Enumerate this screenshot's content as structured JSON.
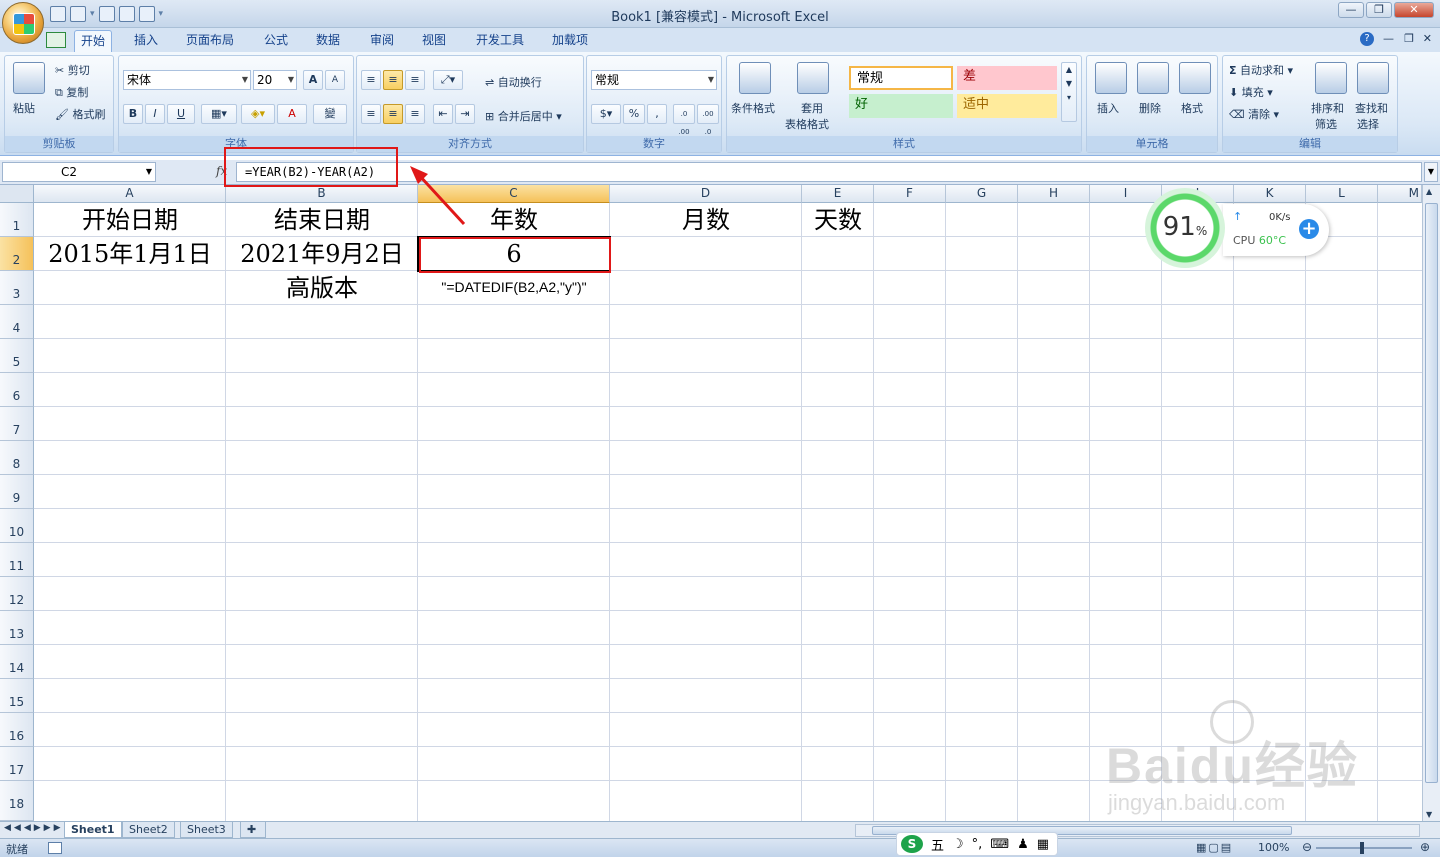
{
  "window": {
    "title": "Book1  [兼容模式] - Microsoft Excel",
    "controls": {
      "minimize": "—",
      "restore": "❐",
      "close": "✕"
    }
  },
  "ribbon": {
    "tabs": [
      "开始",
      "插入",
      "页面布局",
      "公式",
      "数据",
      "审阅",
      "视图",
      "开发工具",
      "加载项"
    ],
    "active_tab": "开始",
    "clipboard": {
      "paste": "粘贴",
      "cut": "剪切",
      "copy": "复制",
      "format_painter": "格式刷",
      "label": "剪贴板"
    },
    "font": {
      "name": "宋体",
      "size": "20",
      "grow": "A",
      "shrink": "A",
      "bold": "B",
      "italic": "I",
      "underline": "U",
      "font_color": "A",
      "wen": "變",
      "label": "字体"
    },
    "alignment": {
      "wrap_text": "自动换行",
      "merge_center": "合并后居中",
      "label": "对齐方式"
    },
    "number": {
      "format": "常规",
      "percent": "%",
      "comma": ",",
      "inc_decimal": ".0 .00",
      "dec_decimal": ".00 .0",
      "label": "数字"
    },
    "styles": {
      "conditional": "条件格式",
      "table_format_1": "套用",
      "table_format_2": "表格格式",
      "normal": "常规",
      "bad": "差",
      "good": "好",
      "neutral": "适中",
      "label": "样式"
    },
    "cells": {
      "insert": "插入",
      "delete": "删除",
      "format": "格式",
      "label": "单元格"
    },
    "editing": {
      "autosum": "自动求和",
      "fill": "填充",
      "clear": "清除",
      "sort_1": "排序和",
      "sort_2": "筛选",
      "find_1": "查找和",
      "find_2": "选择",
      "label": "编辑"
    },
    "sigma": "Σ"
  },
  "formula_bar": {
    "name_box": "C2",
    "fx": "fx",
    "formula": "=YEAR(B2)-YEAR(A2)"
  },
  "columns": [
    "A",
    "B",
    "C",
    "D",
    "E",
    "F",
    "G",
    "H",
    "I",
    "J",
    "K",
    "L",
    "M"
  ],
  "rows": [
    "1",
    "2",
    "3",
    "4",
    "5",
    "6",
    "7",
    "8",
    "9",
    "10",
    "11",
    "12",
    "13",
    "14",
    "15",
    "16",
    "17",
    "18"
  ],
  "cells": {
    "A1": "开始日期",
    "B1": "结束日期",
    "C1": "年数",
    "D1": "月数",
    "E1": "天数",
    "A2": "2015年1月1日",
    "B2": "2021年9月2日",
    "C2": "6",
    "B3": "高版本",
    "C3": "\"=DATEDIF(B2,A2,\"y\")\""
  },
  "sheets": [
    "Sheet1",
    "Sheet2",
    "Sheet3"
  ],
  "active_sheet": "Sheet1",
  "status": {
    "ready": "就绪",
    "zoom": "100%"
  },
  "ime": {
    "logo": "S",
    "mode": "五",
    "moon": "☽",
    "punct": "°,",
    "keyboard": "⌨",
    "person": "♟",
    "grid": "▦"
  },
  "widget": {
    "percent": "91",
    "percent_sign": "%",
    "speed": "0K/s",
    "cpu_label": "CPU",
    "cpu_temp": "60°C"
  },
  "watermark": {
    "brand": "Baidu经验",
    "url": "jingyan.baidu.com"
  },
  "colors": {
    "highlight_red": "#e01818",
    "ribbon_blue": "#dbe8f6",
    "selected_header": "#f5c15a",
    "gauge_green": "#5bd86a"
  }
}
